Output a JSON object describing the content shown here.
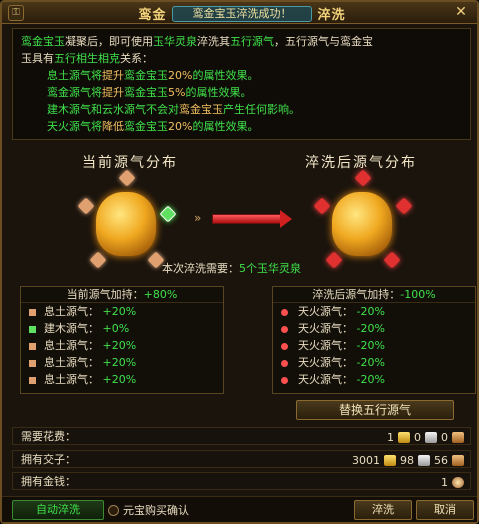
{
  "title": {
    "main_left": "鸾金",
    "toast": "鸾金宝玉淬洗成功！",
    "main_right": "淬洗"
  },
  "desc": {
    "l1_a": "鸾金宝玉",
    "l1_b": "凝聚后，即可使用",
    "l1_c": "玉华灵泉",
    "l1_d": "淬洗其",
    "l1_e": "五行源气",
    "l1_f": "，五行源气与鸾金宝",
    "l2_a": "玉具有",
    "l2_b": "五行相生相克",
    "l2_c": "关系：",
    "l3_a": "息土源气",
    "l3_b": "将",
    "l3_c": "提升",
    "l3_d": "鸾金宝玉",
    "l3_e": "20%",
    "l3_f": "的属性效果。",
    "l4_a": "鸾金源气",
    "l4_b": "将",
    "l4_c": "提升",
    "l4_d": "鸾金宝玉",
    "l4_e": "5%",
    "l4_f": "的属性效果。",
    "l5_a": "建木源气",
    "l5_b": "和",
    "l5_c": "云水源气",
    "l5_d": "不会对",
    "l5_e": "鸾金宝玉",
    "l5_f": "产生任何影响。",
    "l6_a": "天火源气",
    "l6_b": "将",
    "l6_c": "降低",
    "l6_d": "鸾金宝玉",
    "l6_e": "20%",
    "l6_f": "的属性效果。"
  },
  "current_title": "当前源气分布",
  "after_title": "淬洗后源气分布",
  "wash_cost": {
    "label": "本次淬洗需要：",
    "amount": "5个玉华灵泉"
  },
  "current_panel": {
    "head_label": "当前源气加持：",
    "head_value": "+80%",
    "rows": [
      {
        "name": "息土源气：",
        "value": "+20%"
      },
      {
        "name": "建木源气：",
        "value": "+0%"
      },
      {
        "name": "息土源气：",
        "value": "+20%"
      },
      {
        "name": "息土源气：",
        "value": "+20%"
      },
      {
        "name": "息土源气：",
        "value": "+20%"
      }
    ]
  },
  "after_panel": {
    "head_label": "淬洗后源气加持：",
    "head_value": "-100%",
    "rows": [
      {
        "name": "天火源气：",
        "value": "-20%"
      },
      {
        "name": "天火源气：",
        "value": "-20%"
      },
      {
        "name": "天火源气：",
        "value": "-20%"
      },
      {
        "name": "天火源气：",
        "value": "-20%"
      },
      {
        "name": "天火源气：",
        "value": "-20%"
      }
    ]
  },
  "replace_button": "替换五行源气",
  "costs": {
    "need_label": "需要花费：",
    "need_gold": "1",
    "need_silver": "0",
    "need_bronze": "0",
    "own_label": "拥有交子：",
    "own_gold": "3001",
    "own_silver": "98",
    "own_bronze": "56",
    "money_label": "拥有金钱：",
    "money": "1"
  },
  "bottom": {
    "auto": "自动淬洗",
    "buy_confirm": "元宝购买确认",
    "wash": "淬洗",
    "cancel": "取消"
  }
}
